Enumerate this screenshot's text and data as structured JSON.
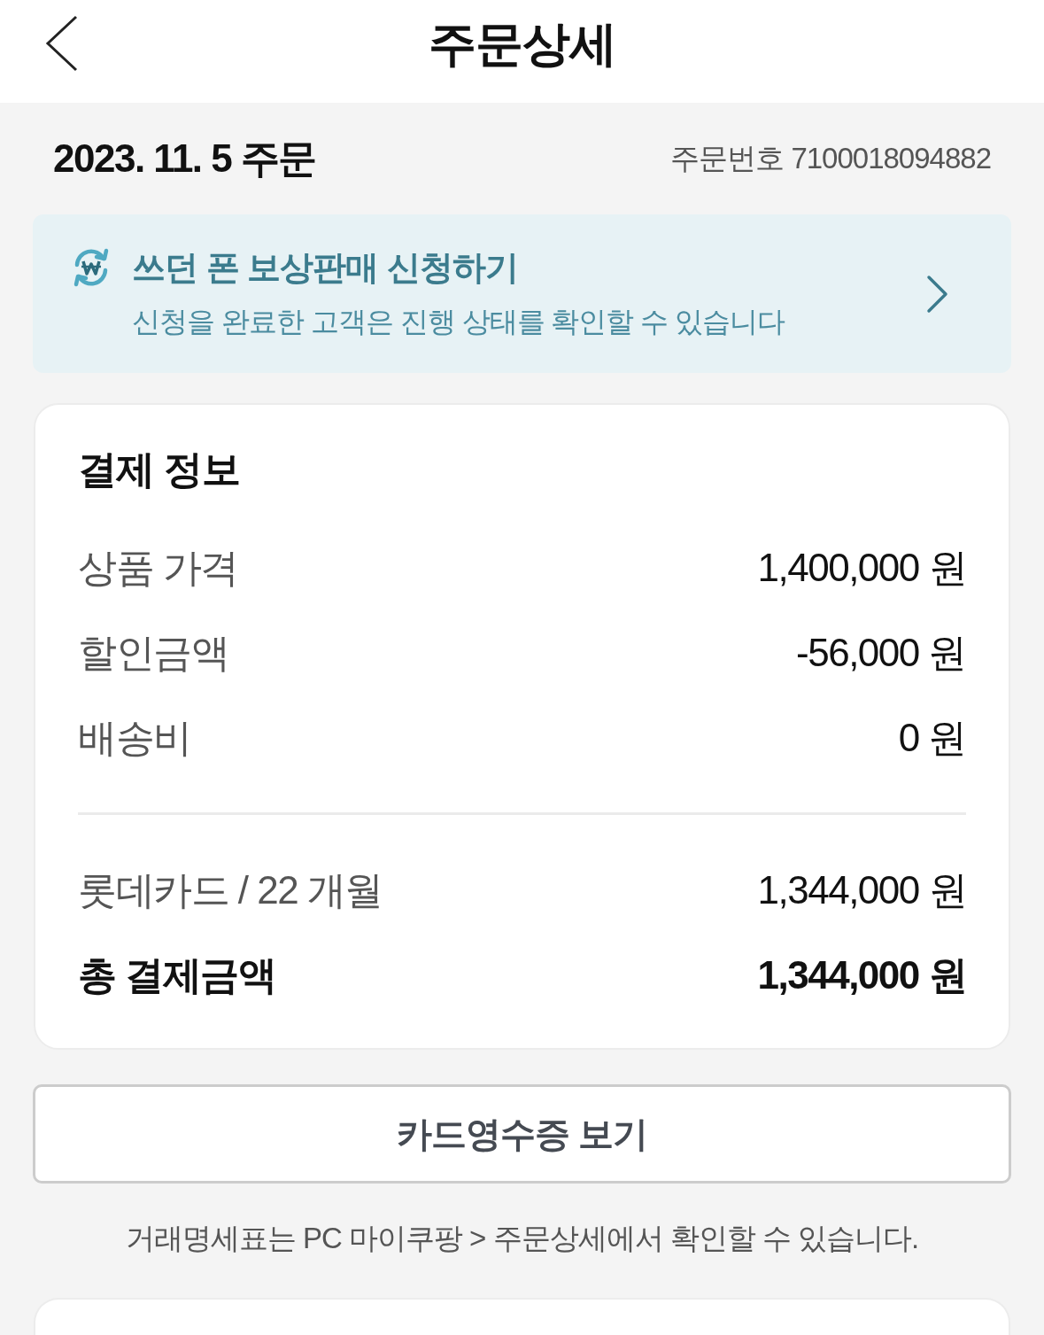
{
  "header": {
    "title": "주문상세"
  },
  "order": {
    "date": "2023. 11. 5 주문",
    "number": "주문번호 7100018094882"
  },
  "trade_in_banner": {
    "title": "쓰던 폰 보상판매 신청하기",
    "subtitle": "신청을 완료한 고객은 진행 상태를 확인할 수 있습니다"
  },
  "payment_info": {
    "title": "결제 정보",
    "charges": [
      {
        "label": "상품 가격",
        "value": "1,400,000 원"
      },
      {
        "label": "할인금액",
        "value": "-56,000 원"
      },
      {
        "label": "배송비",
        "value": "0 원"
      }
    ],
    "payment": [
      {
        "kind": "method",
        "label": "롯데카드 / 22 개월",
        "value": "1,344,000 원"
      },
      {
        "kind": "total",
        "label": "총 결제금액",
        "value": "1,344,000 원"
      }
    ]
  },
  "receipt_button": {
    "label": "카드영수증 보기"
  },
  "note": "거래명세표는 PC 마이쿠팡 > 주문상세에서 확인할 수 있습니다."
}
